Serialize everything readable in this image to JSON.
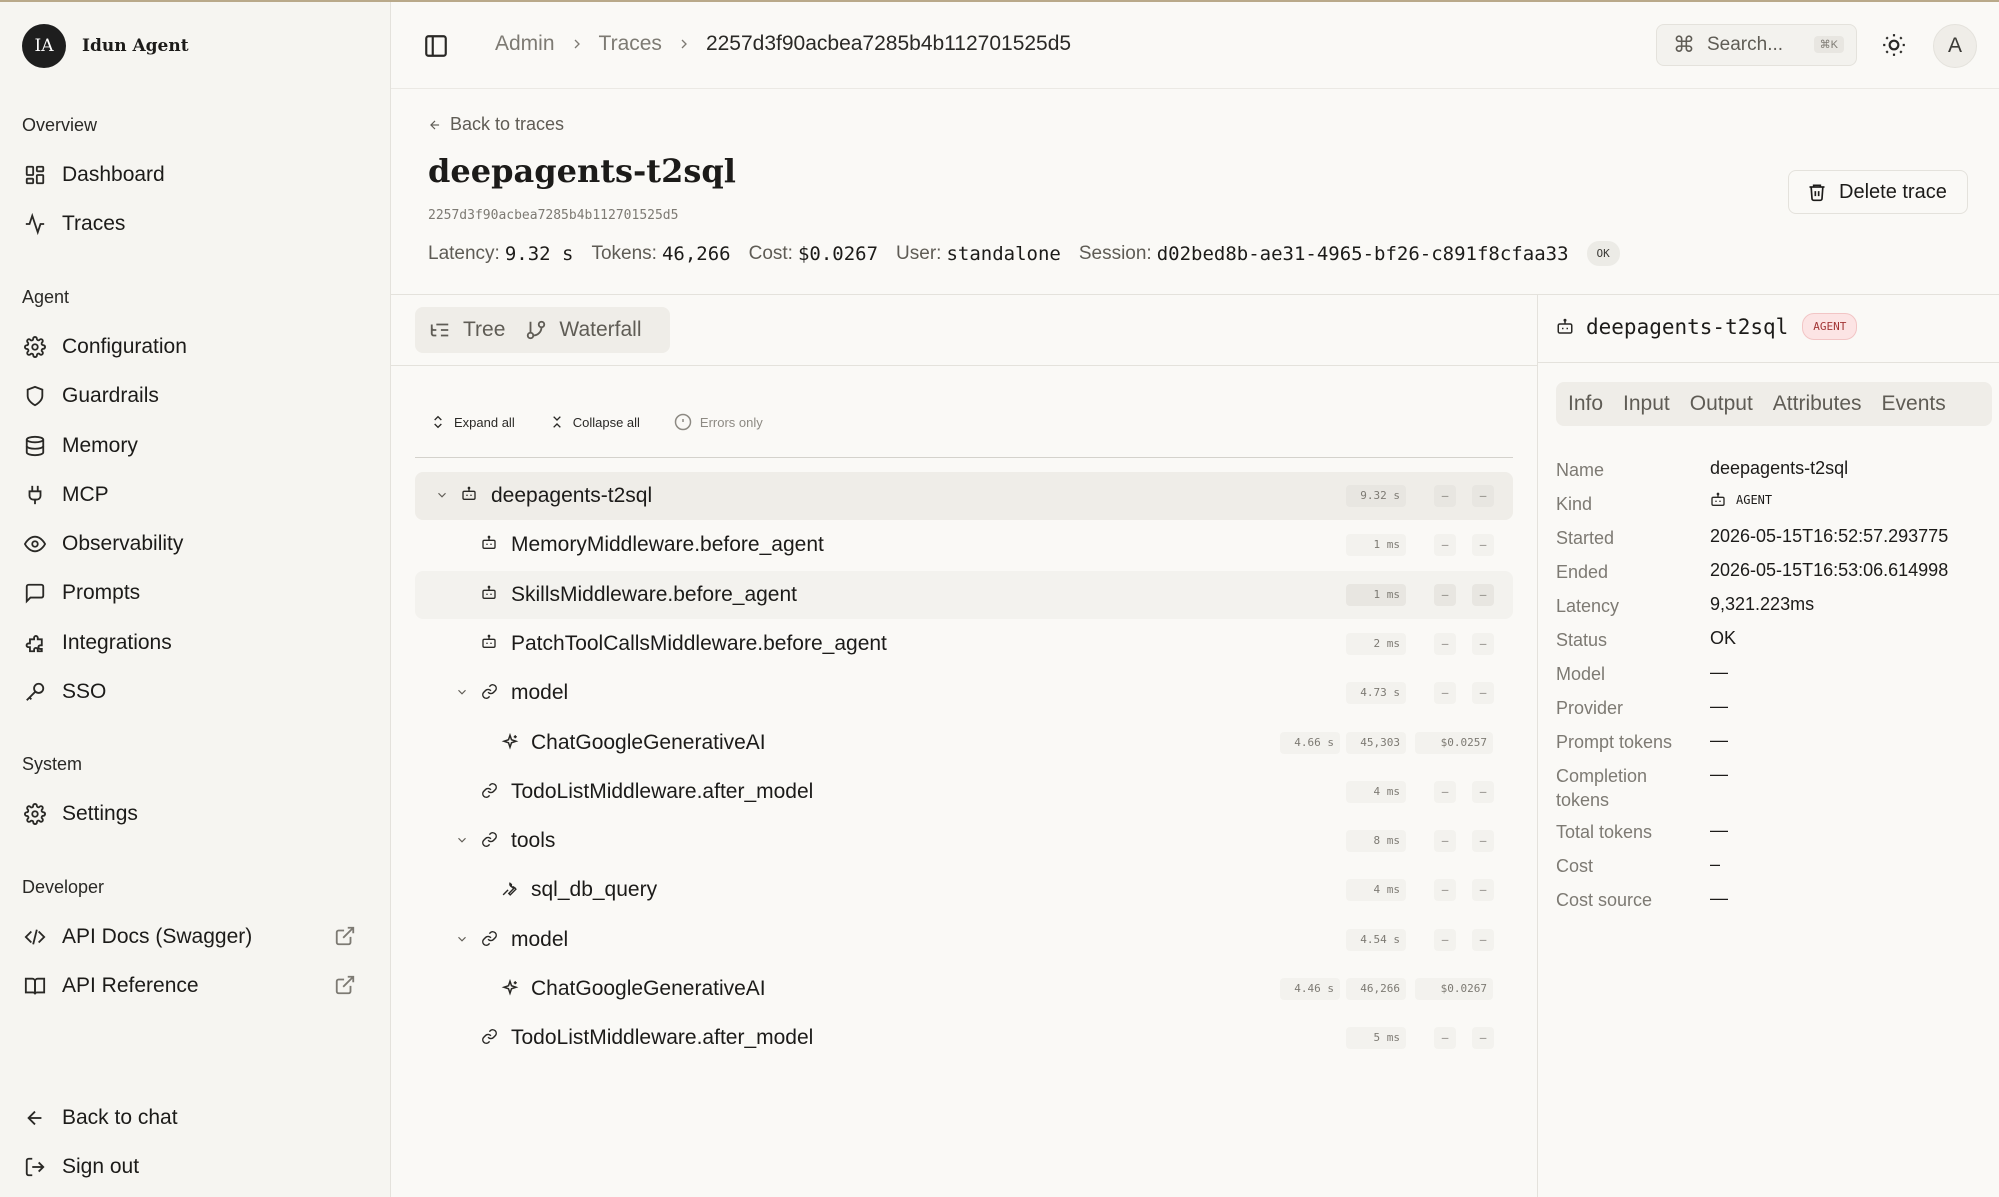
{
  "brand": {
    "initials": "IA",
    "name": "Idun Agent"
  },
  "nav": {
    "overview_label": "Overview",
    "overview": [
      {
        "label": "Dashboard",
        "icon": "dashboard-icon"
      },
      {
        "label": "Traces",
        "icon": "activity-icon"
      }
    ],
    "agent_label": "Agent",
    "agent": [
      {
        "label": "Configuration",
        "icon": "gear-icon"
      },
      {
        "label": "Guardrails",
        "icon": "shield-icon"
      },
      {
        "label": "Memory",
        "icon": "database-icon"
      },
      {
        "label": "MCP",
        "icon": "plug-icon"
      },
      {
        "label": "Observability",
        "icon": "eye-icon"
      },
      {
        "label": "Prompts",
        "icon": "message-icon"
      },
      {
        "label": "Integrations",
        "icon": "puzzle-icon"
      },
      {
        "label": "SSO",
        "icon": "key-icon"
      }
    ],
    "system_label": "System",
    "system": [
      {
        "label": "Settings",
        "icon": "gear-icon"
      }
    ],
    "developer_label": "Developer",
    "developer": [
      {
        "label": "API Docs (Swagger)",
        "icon": "code-icon"
      },
      {
        "label": "API Reference",
        "icon": "book-icon"
      }
    ],
    "footer": [
      {
        "label": "Back to chat",
        "icon": "arrow-left-icon"
      },
      {
        "label": "Sign out",
        "icon": "sign-out-icon"
      }
    ]
  },
  "topbar": {
    "breadcrumb": [
      "Admin",
      "Traces",
      "2257d3f90acbea7285b4b112701525d5"
    ],
    "search_placeholder": "Search...",
    "search_shortcut": "⌘K",
    "avatar_initial": "A"
  },
  "trace": {
    "back_label": "Back to traces",
    "title": "deepagents-t2sql",
    "id": "2257d3f90acbea7285b4b112701525d5",
    "delete_label": "Delete trace",
    "meta": {
      "latency_label": "Latency:",
      "latency": "9.32 s",
      "tokens_label": "Tokens:",
      "tokens": "46,266",
      "cost_label": "Cost:",
      "cost": "$0.0267",
      "user_label": "User:",
      "user": "standalone",
      "session_label": "Session:",
      "session": "d02bed8b-ae31-4965-bf26-c891f8cfaa33",
      "status": "OK"
    }
  },
  "views": {
    "tree": "Tree",
    "waterfall": "Waterfall"
  },
  "tree_tools": {
    "expand": "Expand all",
    "collapse": "Collapse all",
    "errors": "Errors only"
  },
  "spans": [
    {
      "label": "deepagents-t2sql",
      "depth": 0,
      "chevron": true,
      "icon": "bot-icon",
      "duration": "9.32 s",
      "tokens": "–",
      "cost": "–",
      "state": "selected"
    },
    {
      "label": "MemoryMiddleware.before_agent",
      "depth": 1,
      "chevron": false,
      "icon": "bot-icon",
      "duration": "1 ms",
      "tokens": "–",
      "cost": "–",
      "state": ""
    },
    {
      "label": "SkillsMiddleware.before_agent",
      "depth": 1,
      "chevron": false,
      "icon": "bot-icon",
      "duration": "1 ms",
      "tokens": "–",
      "cost": "–",
      "state": "hover"
    },
    {
      "label": "PatchToolCallsMiddleware.before_agent",
      "depth": 1,
      "chevron": false,
      "icon": "bot-icon",
      "duration": "2 ms",
      "tokens": "–",
      "cost": "–",
      "state": ""
    },
    {
      "label": "model",
      "depth": 1,
      "chevron": true,
      "icon": "link-icon",
      "duration": "4.73 s",
      "tokens": "–",
      "cost": "–",
      "state": ""
    },
    {
      "label": "ChatGoogleGenerativeAI",
      "depth": 2,
      "chevron": false,
      "icon": "sparkle-icon",
      "duration": "4.66 s",
      "tokens": "45,303",
      "cost": "$0.0257",
      "state": ""
    },
    {
      "label": "TodoListMiddleware.after_model",
      "depth": 1,
      "chevron": false,
      "icon": "link-icon",
      "duration": "4 ms",
      "tokens": "–",
      "cost": "–",
      "state": ""
    },
    {
      "label": "tools",
      "depth": 1,
      "chevron": true,
      "icon": "link-icon",
      "duration": "8 ms",
      "tokens": "–",
      "cost": "–",
      "state": ""
    },
    {
      "label": "sql_db_query",
      "depth": 2,
      "chevron": false,
      "icon": "wrench-icon",
      "duration": "4 ms",
      "tokens": "–",
      "cost": "–",
      "state": ""
    },
    {
      "label": "model",
      "depth": 1,
      "chevron": true,
      "icon": "link-icon",
      "duration": "4.54 s",
      "tokens": "–",
      "cost": "–",
      "state": ""
    },
    {
      "label": "ChatGoogleGenerativeAI",
      "depth": 2,
      "chevron": false,
      "icon": "sparkle-icon",
      "duration": "4.46 s",
      "tokens": "46,266",
      "cost": "$0.0267",
      "state": ""
    },
    {
      "label": "TodoListMiddleware.after_model",
      "depth": 1,
      "chevron": false,
      "icon": "link-icon",
      "duration": "5 ms",
      "tokens": "–",
      "cost": "–",
      "state": ""
    }
  ],
  "detail": {
    "name": "deepagents-t2sql",
    "badge": "AGENT",
    "tabs": [
      "Info",
      "Input",
      "Output",
      "Attributes",
      "Events"
    ],
    "fields": [
      {
        "key": "Name",
        "value": "deepagents-t2sql"
      },
      {
        "key": "Kind",
        "value": "AGENT",
        "kind": true
      },
      {
        "key": "Started",
        "value": "2026-05-15T16:52:57.293775"
      },
      {
        "key": "Ended",
        "value": "2026-05-15T16:53:06.614998"
      },
      {
        "key": "Latency",
        "value": "9,321.223ms"
      },
      {
        "key": "Status",
        "value": "OK"
      },
      {
        "key": "Model",
        "value": "—"
      },
      {
        "key": "Provider",
        "value": "—"
      },
      {
        "key": "Prompt tokens",
        "value": "—"
      },
      {
        "key": "Completion tokens",
        "value": "—"
      },
      {
        "key": "Total tokens",
        "value": "—"
      },
      {
        "key": "Cost",
        "value": "–"
      },
      {
        "key": "Cost source",
        "value": "—"
      }
    ]
  },
  "colors": {
    "accent": "#1e1e1e",
    "agent_badge_bg": "#fce4e4",
    "agent_badge_fg": "#a33636",
    "selected_row": "#efede8"
  }
}
